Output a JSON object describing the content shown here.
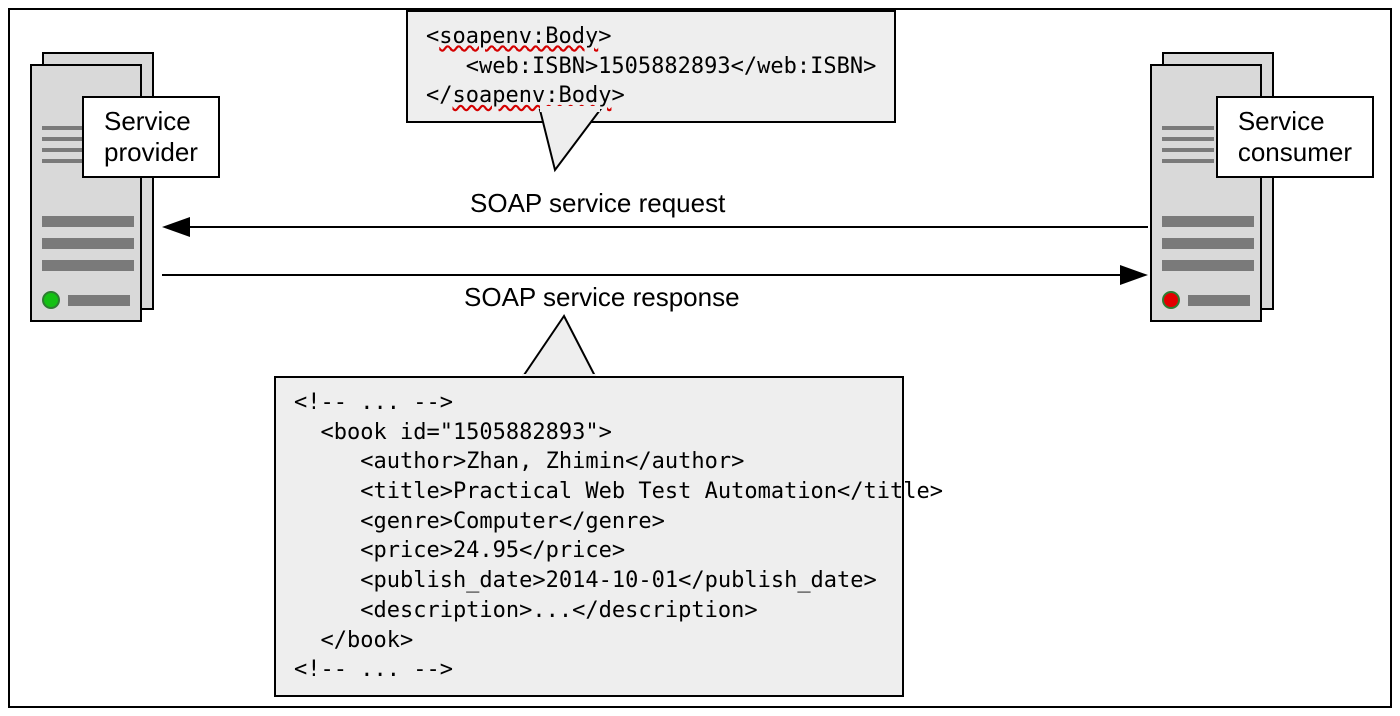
{
  "provider": {
    "label": "Service\nprovider",
    "led_color": "#14c114",
    "led_border": "#2e7d32"
  },
  "consumer": {
    "label": "Service\nconsumer",
    "led_color": "#e30000",
    "led_border": "#2e7d32"
  },
  "arrows": {
    "request_label": "SOAP service request",
    "response_label": "SOAP service response"
  },
  "request_bubble": {
    "line1_open": "<",
    "line1_tag": "soapenv:Body",
    "line1_close": ">",
    "line2": "   <web:ISBN>1505882893</web:ISBN>",
    "line3_open": "</",
    "line3_tag": "soapenv:Body",
    "line3_close": ">"
  },
  "response_bubble": {
    "code": "<!-- ... -->\n  <book id=\"1505882893\">\n     <author>Zhan, Zhimin</author>\n     <title>Practical Web Test Automation</title>\n     <genre>Computer</genre>\n     <price>24.95</price>\n     <publish_date>2014-10-01</publish_date>\n     <description>...</description>\n  </book>\n<!-- ... -->"
  }
}
